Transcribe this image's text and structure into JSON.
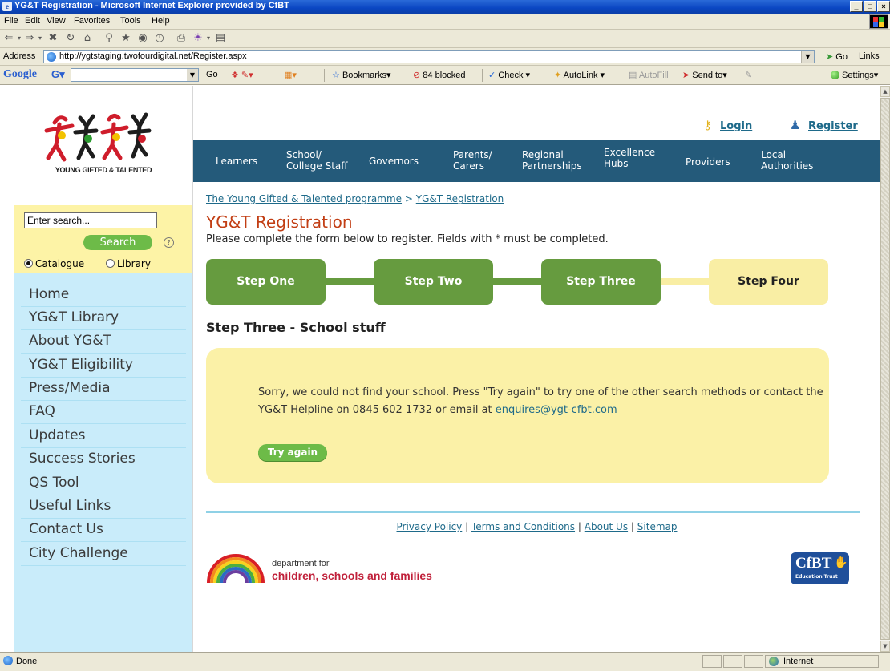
{
  "window": {
    "title": "YG&T Registration - Microsoft Internet Explorer provided by CfBT",
    "buttons": [
      "_",
      "□",
      "×"
    ]
  },
  "menubar": [
    "File",
    "Edit",
    "View",
    "Favorites",
    "Tools",
    "Help"
  ],
  "address": {
    "label": "Address",
    "url": "http://ygtstaging.twofourdigital.net/Register.aspx",
    "go_label": "Go",
    "links_label": "Links"
  },
  "googlebar": {
    "logo": "Google",
    "go": "Go",
    "bookmarks": "Bookmarks▾",
    "blocked": "84 blocked",
    "check": "Check ▾",
    "autolink": "AutoLink ▾",
    "autofill": "AutoFill",
    "sendto": "Send to▾",
    "settings": "Settings▾"
  },
  "status": {
    "text": "Done",
    "zone": "Internet"
  },
  "site": {
    "logo_text": "YOUNG GIFTED & TALENTED",
    "search": {
      "placeholder": "Enter search...",
      "button": "Search",
      "help": "?",
      "options": [
        "Catalogue",
        "Library"
      ],
      "selected": "Catalogue"
    },
    "left_nav": [
      "Home",
      "YG&T Library",
      "About YG&T",
      "YG&T Eligibility",
      "Press/Media",
      "FAQ",
      "Updates",
      "Success Stories",
      "QS Tool",
      "Useful Links",
      "Contact Us",
      "City Challenge"
    ],
    "top_links": {
      "login": "Login",
      "register": "Register"
    },
    "top_nav": [
      [
        "Learners"
      ],
      [
        "School/",
        "College Staff"
      ],
      [
        "Governors"
      ],
      [
        "Parents/",
        "Carers"
      ],
      [
        "Regional",
        "Partnerships"
      ],
      [
        "Excellence",
        "Hubs"
      ],
      [
        "Providers"
      ],
      [
        "Local",
        "Authorities"
      ]
    ],
    "breadcrumb": {
      "home": "The Young Gifted & Talented programme",
      "sep": ">",
      "current": "YG&T Registration"
    },
    "title": "YG&T Registration",
    "instructions": "Please complete the form below to register. Fields with * must be completed.",
    "steps": [
      {
        "label": "Step One",
        "done": true
      },
      {
        "label": "Step Two",
        "done": true
      },
      {
        "label": "Step Three",
        "done": true
      },
      {
        "label": "Step Four",
        "done": false
      }
    ],
    "section_heading": "Step Three - School stuff",
    "message": {
      "text": "Sorry, we could not find your school. Press \"Try again\" to try one of the other search methods or contact the YG&T Helpline on 0845 602 1732 or email at ",
      "email": "enquires@ygt-cfbt.com",
      "button": "Try again"
    },
    "footer_links": [
      "Privacy Policy",
      "Terms and Conditions",
      "About Us",
      "Sitemap"
    ],
    "footer_sep": "|",
    "dcsf": {
      "line1": "department for",
      "line2": "children, schools and families"
    },
    "cfbt": {
      "name": "CfBT",
      "tagline": "Education Trust"
    }
  },
  "colors": {
    "nav_blue": "#245a7a",
    "step_done": "#669b3f",
    "step_todo": "#f9eea4",
    "title_red": "#c23e14",
    "link": "#1e6a8a",
    "sidebar_blue": "#c9ecfa",
    "panel_yellow": "#fbf1a7"
  }
}
